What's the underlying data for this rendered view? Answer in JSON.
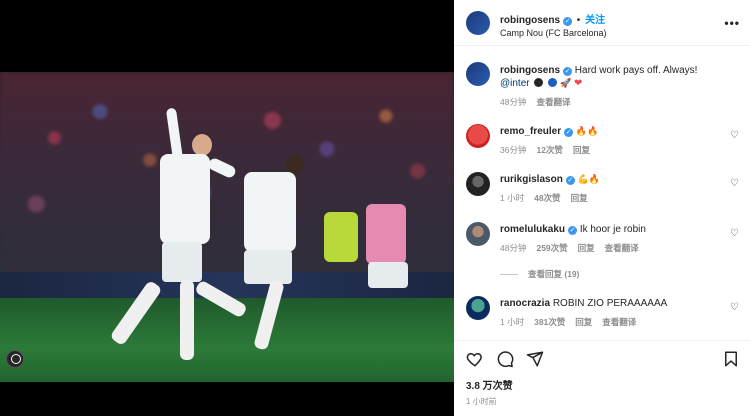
{
  "post": {
    "author": "robingosens",
    "follow_label": "关注",
    "location": "Camp Nou (FC Barcelona)",
    "caption_text": "Hard work pays off. Always!",
    "caption_mention": "@inter",
    "caption_time": "48分钟",
    "caption_translate": "查看翻译",
    "likes": "3.8 万次赞",
    "posted_time": "1 小时前"
  },
  "comments": [
    {
      "user": "remo_freuler",
      "text": "",
      "time": "36分钟",
      "likes": "12次赞",
      "reply": "回复",
      "translate": ""
    },
    {
      "user": "rurikgislason",
      "text": "",
      "time": "1 小时",
      "likes": "48次赞",
      "reply": "回复",
      "translate": ""
    },
    {
      "user": "romelulukaku",
      "text": "Ik hoor je robin",
      "time": "48分钟",
      "likes": "259次赞",
      "reply": "回复",
      "translate": "查看翻译",
      "view_replies": "查看回复 (19)"
    },
    {
      "user": "ranocrazia",
      "text": "ROBIN ZIO PERAAAAAA",
      "time": "1 小时",
      "likes": "381次赞",
      "reply": "回复",
      "translate": "查看翻译"
    }
  ],
  "icons": {
    "more": "more-icon",
    "like": "heart-icon",
    "comment": "comment-icon",
    "share": "share-icon",
    "save": "bookmark-icon"
  },
  "colors": {
    "link": "#0095f6",
    "verified": "#3897f0",
    "muted": "#8e8e8e"
  }
}
